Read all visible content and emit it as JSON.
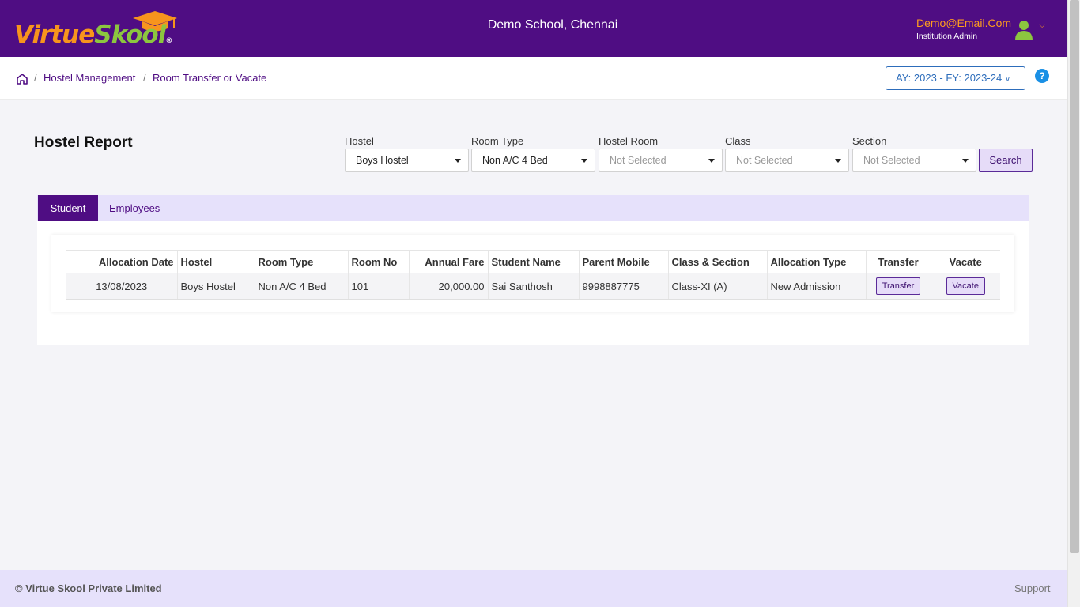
{
  "header": {
    "logo_part1": "Virtue",
    "logo_part2": "Skool",
    "logo_reg": "®",
    "school_name": "Demo School, Chennai",
    "user_email": "Demo@Email.Com",
    "user_role": "Institution Admin"
  },
  "breadcrumb": {
    "items": [
      "Hostel Management",
      "Room Transfer or Vacate"
    ],
    "separator": "/"
  },
  "academic_year": "AY: 2023 - FY: 2023-24",
  "help_label": "?",
  "page_title": "Hostel Report",
  "filters": [
    {
      "label": "Hostel",
      "value": "Boys Hostel"
    },
    {
      "label": "Room Type",
      "value": "Non A/C 4 Bed"
    },
    {
      "label": "Hostel Room",
      "value": "Not Selected"
    },
    {
      "label": "Class",
      "value": "Not Selected"
    },
    {
      "label": "Section",
      "value": "Not Selected"
    }
  ],
  "search_label": "Search",
  "tabs": [
    "Student",
    "Employees"
  ],
  "table": {
    "columns": [
      "Allocation Date",
      "Hostel",
      "Room Type",
      "Room No",
      "Annual Fare",
      "Student Name",
      "Parent Mobile",
      "Class & Section",
      "Allocation Type",
      "Transfer",
      "Vacate"
    ],
    "rows": [
      {
        "allocation_date": "13/08/2023",
        "hostel": "Boys Hostel",
        "room_type": "Non A/C 4 Bed",
        "room_no": "101",
        "annual_fare": "20,000.00",
        "student_name": "Sai Santhosh",
        "parent_mobile": "9998887775",
        "class_section": "Class-XI (A)",
        "allocation_type": "New Admission",
        "transfer_label": "Transfer",
        "vacate_label": "Vacate"
      }
    ]
  },
  "footer": {
    "copyright": "© Virtue Skool Private Limited",
    "support": "Support"
  },
  "colors": {
    "brand_purple": "#4f0d83",
    "logo_orange": "#f7941d",
    "logo_green": "#8cc63f",
    "tab_strip": "#e6e1fb",
    "link_blue": "#2d6dbb"
  },
  "icons": [
    "graduation-cap-icon",
    "user-avatar-icon",
    "chevron-down-icon",
    "home-icon",
    "help-icon",
    "dropdown-caret-icon"
  ]
}
